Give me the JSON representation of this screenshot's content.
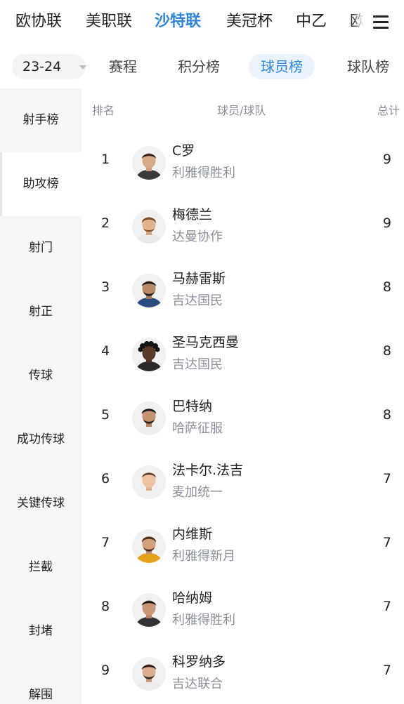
{
  "league_nav": {
    "items": [
      "欧协联",
      "美职联",
      "沙特联",
      "美冠杯",
      "中乙",
      "欧"
    ],
    "active_index": 2
  },
  "filter": {
    "season": "23-24",
    "tabs": [
      "赛程",
      "积分榜",
      "球员榜",
      "球队榜"
    ],
    "active_tab_index": 2
  },
  "sidebar": {
    "items": [
      "射手榜",
      "助攻榜",
      "射门",
      "射正",
      "传球",
      "成功传球",
      "关键传球",
      "拦截",
      "封堵",
      "解围"
    ],
    "active_index": 1
  },
  "table": {
    "headers": {
      "rank": "排名",
      "player_team": "球员/球队",
      "total": "总计"
    },
    "rows": [
      {
        "rank": "1",
        "name": "C罗",
        "team": "利雅得胜利",
        "total": "9"
      },
      {
        "rank": "2",
        "name": "梅德兰",
        "team": "达曼协作",
        "total": "9"
      },
      {
        "rank": "3",
        "name": "马赫雷斯",
        "team": "吉达国民",
        "total": "8"
      },
      {
        "rank": "4",
        "name": "圣马克西曼",
        "team": "吉达国民",
        "total": "8"
      },
      {
        "rank": "5",
        "name": "巴特纳",
        "team": "哈萨征服",
        "total": "8"
      },
      {
        "rank": "6",
        "name": "法卡尔.法吉",
        "team": "麦加统一",
        "total": "7"
      },
      {
        "rank": "7",
        "name": "内维斯",
        "team": "利雅得新月",
        "total": "7"
      },
      {
        "rank": "8",
        "name": "哈纳姆",
        "team": "利雅得胜利",
        "total": "7"
      },
      {
        "rank": "9",
        "name": "科罗纳多",
        "team": "吉达联合",
        "total": "7"
      }
    ]
  },
  "colors": {
    "accent": "#2f86d8",
    "text": "#222222",
    "muted": "#8a8f99",
    "sidebar_bg": "#f5f6f8"
  },
  "icons": {
    "menu": "hamburger-menu-icon",
    "season_caret": "caret-down-icon",
    "avatar": "player-avatar"
  }
}
